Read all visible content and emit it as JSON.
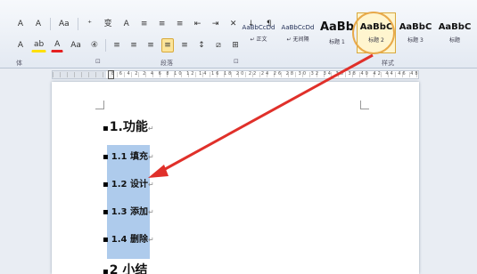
{
  "ribbon": {
    "row1": [
      "A",
      "A",
      "Aa",
      "⁺",
      "变",
      "A",
      "≡",
      "≡",
      "≡",
      "⇤",
      "⇥",
      "✕",
      "↓",
      "¶"
    ],
    "row2": [
      "A",
      "ab",
      "A",
      "Aa",
      "④",
      "≡",
      "≡",
      "≡",
      "≡",
      "≡",
      "↕",
      "⧄",
      "⊞"
    ],
    "paragraph_group_label": "段落",
    "font_group_label": "体",
    "styles_group_label": "样式",
    "launcher_glyph": "⊡"
  },
  "styles": [
    {
      "preview": "AaBbCcDd",
      "name": "↵ 正文"
    },
    {
      "preview": "AaBbCcDd",
      "name": "↵ 无间隔"
    },
    {
      "preview": "AaBb",
      "name": "标题 1"
    },
    {
      "preview": "AaBbC",
      "name": "标题 2"
    },
    {
      "preview": "AaBbC",
      "name": "标题 3"
    },
    {
      "preview": "AaBbC",
      "name": "标题"
    }
  ],
  "ruler": {
    "numbers": "8 6 4 2  2 4 6 8 10 12 14 16 18 20 22 24 26 28 30 32 34 36 38 40 42 44 46 48"
  },
  "document": {
    "heading1": "1.功能",
    "subheadings": [
      "1.1 填充",
      "1.2 设计",
      "1.3 添加",
      "1.4 删除"
    ],
    "heading2": "2 小结",
    "bullet": "▪",
    "paragraph_mark": "↵"
  },
  "colors": {
    "arrow": "#e0302a",
    "highlight_circle": "#e8a94a",
    "selection": "#aecbec"
  }
}
